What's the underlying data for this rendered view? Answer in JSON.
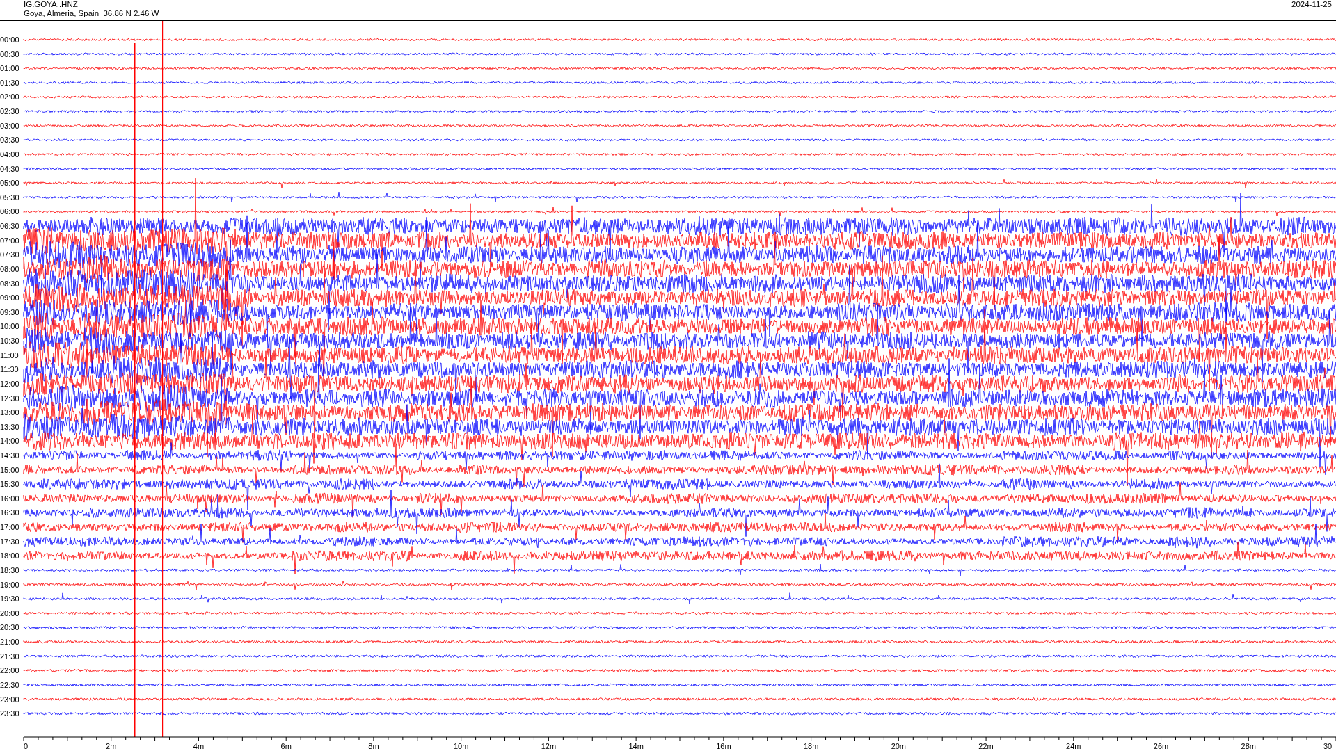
{
  "header": {
    "station": "IG.GOYA..HNZ",
    "location": "Goya, Almeria, Spain  36.86 N 2.46 W",
    "date": "2024-11-25"
  },
  "rows": [
    "00:00",
    "00:30",
    "01:00",
    "01:30",
    "02:00",
    "02:30",
    "03:00",
    "03:30",
    "04:00",
    "04:30",
    "05:00",
    "05:30",
    "06:00",
    "06:30",
    "07:00",
    "07:30",
    "08:00",
    "08:30",
    "09:00",
    "09:30",
    "10:00",
    "10:30",
    "11:00",
    "11:30",
    "12:00",
    "12:30",
    "13:00",
    "13:30",
    "14:00",
    "14:30",
    "15:00",
    "15:30",
    "16:00",
    "16:30",
    "17:00",
    "17:30",
    "18:00",
    "18:30",
    "19:00",
    "19:30",
    "20:00",
    "20:30",
    "21:00",
    "21:30",
    "22:00",
    "22:30",
    "23:00",
    "23:30"
  ],
  "x_axis": [
    "0",
    "2m",
    "4m",
    "6m",
    "8m",
    "10m",
    "12m",
    "14m",
    "16m",
    "18m",
    "20m",
    "22m",
    "24m",
    "26m",
    "28m",
    "30"
  ]
}
